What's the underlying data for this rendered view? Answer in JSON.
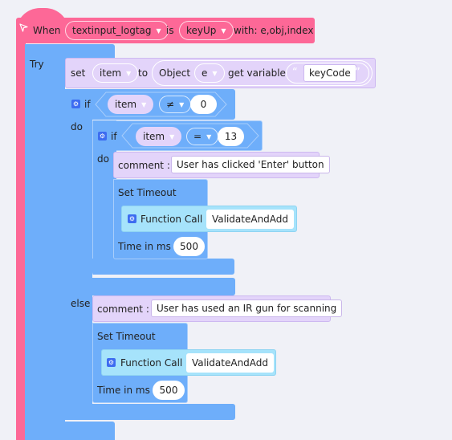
{
  "event_block": {
    "icon": "cursor-arrow-icon",
    "when_label": "When",
    "component": "textinput_logtag",
    "is_label": "is",
    "event": "keyUp",
    "with_label": "with: e,obj,index"
  },
  "try_block": {
    "label": "Try"
  },
  "set_block": {
    "set_label": "set",
    "variable": "item",
    "to_label": "to",
    "object_label": "Object",
    "object_var": "e",
    "get_label": "get variable",
    "open_quote": "“",
    "key": "keyCode",
    "close_quote": "”"
  },
  "if_outer": {
    "if_label": "if",
    "left": "item",
    "operator": "≠",
    "right": "0",
    "do_label": "do",
    "else_label": "else"
  },
  "if_inner": {
    "if_label": "if",
    "left": "item",
    "operator": "=",
    "right": "13",
    "do_label": "do"
  },
  "inner_do": {
    "comment_label": "comment :",
    "comment_text": "User has clicked 'Enter' button",
    "timeout_label": "Set Timeout",
    "function_label": "Function Call",
    "function_name": "ValidateAndAdd",
    "time_label": "Time in ms",
    "time_value": "500"
  },
  "else_do": {
    "comment_label": "comment :",
    "comment_text": "User has used an IR gun for scanning",
    "timeout_label": "Set Timeout",
    "function_label": "Function Call",
    "function_name": "ValidateAndAdd",
    "time_label": "Time in ms",
    "time_value": "500"
  },
  "colors": {
    "event": "#fd6897",
    "control": "#6eaefa",
    "variable": "#e3d4fa",
    "function": "#a6e3fb",
    "background": "#f0f1f7"
  }
}
